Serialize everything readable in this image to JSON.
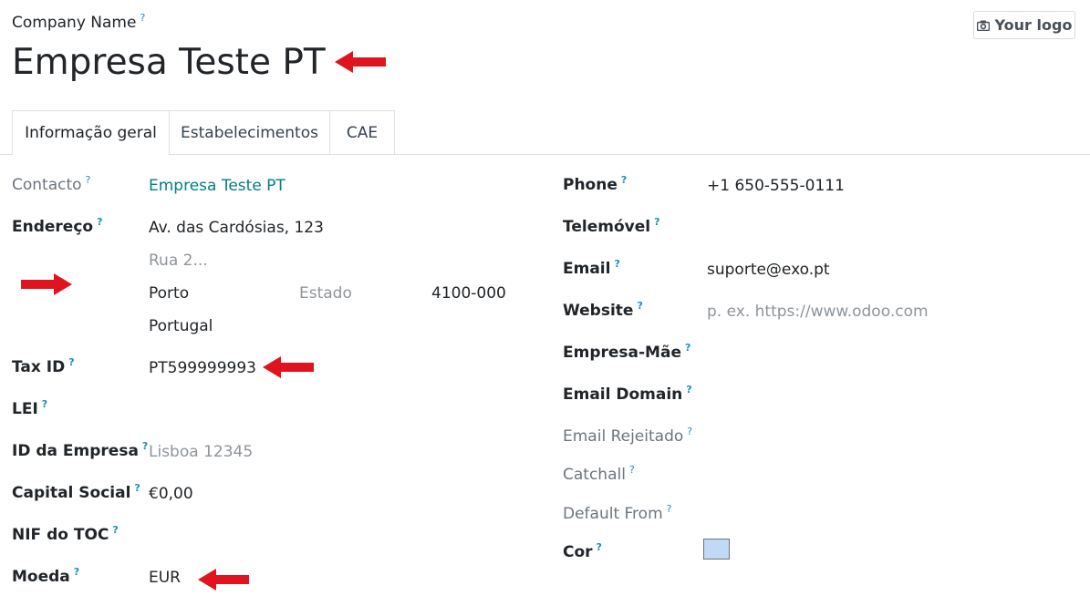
{
  "header": {
    "company_name_label": "Company Name",
    "help_mark": "?",
    "company_name": "Empresa Teste PT",
    "logo_button": "Your logo"
  },
  "tabs": [
    {
      "label": "Informação geral",
      "active": true
    },
    {
      "label": "Estabelecimentos",
      "active": false
    },
    {
      "label": "CAE",
      "active": false
    }
  ],
  "left": {
    "contacto_label": "Contacto",
    "contacto_value": "Empresa Teste PT",
    "endereco_label": "Endereço",
    "street": "Av. das Cardósias, 123",
    "street2_placeholder": "Rua 2...",
    "city": "Porto",
    "state_placeholder": "Estado",
    "zip": "4100-000",
    "country": "Portugal",
    "taxid_label": "Tax ID",
    "taxid_value": "PT599999993",
    "lei_label": "LEI",
    "company_id_label": "ID da Empresa",
    "company_id_placeholder": "Lisboa 12345",
    "capital_label": "Capital Social",
    "capital_value": "€0,00",
    "nif_toc_label": "NIF do TOC",
    "moeda_label": "Moeda",
    "moeda_value": "EUR"
  },
  "right": {
    "phone_label": "Phone",
    "phone_value": "+1 650-555-0111",
    "mobile_label": "Telemóvel",
    "email_label": "Email",
    "email_value": "suporte@exo.pt",
    "website_label": "Website",
    "website_placeholder": "p. ex. https://www.odoo.com",
    "parent_label": "Empresa-Mãe",
    "email_domain_label": "Email Domain",
    "bounce_label": "Email Rejeitado",
    "catchall_label": "Catchall",
    "default_from_label": "Default From",
    "color_label": "Cor"
  },
  "colors": {
    "accent_link": "#017e84",
    "annotation_arrow": "#e0141e",
    "swatch": "#c0d9f4"
  }
}
